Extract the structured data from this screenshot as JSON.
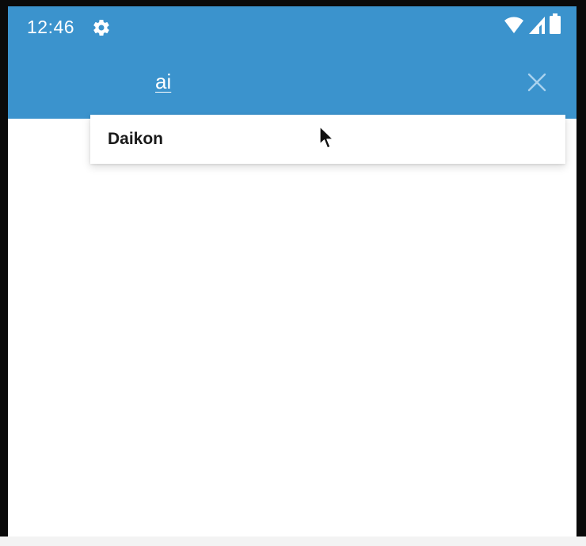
{
  "status_bar": {
    "time": "12:46",
    "icons": [
      "gear-icon",
      "wifi-icon",
      "signal-icon",
      "battery-icon"
    ]
  },
  "app_bar": {
    "search_value": "ai",
    "close_icon": "close-icon"
  },
  "suggestions": {
    "items": [
      {
        "label": "Daikon"
      }
    ]
  },
  "colors": {
    "accent": "#3b93cd",
    "on_accent": "#ffffff",
    "suggestion_text": "#1a1a1a"
  }
}
